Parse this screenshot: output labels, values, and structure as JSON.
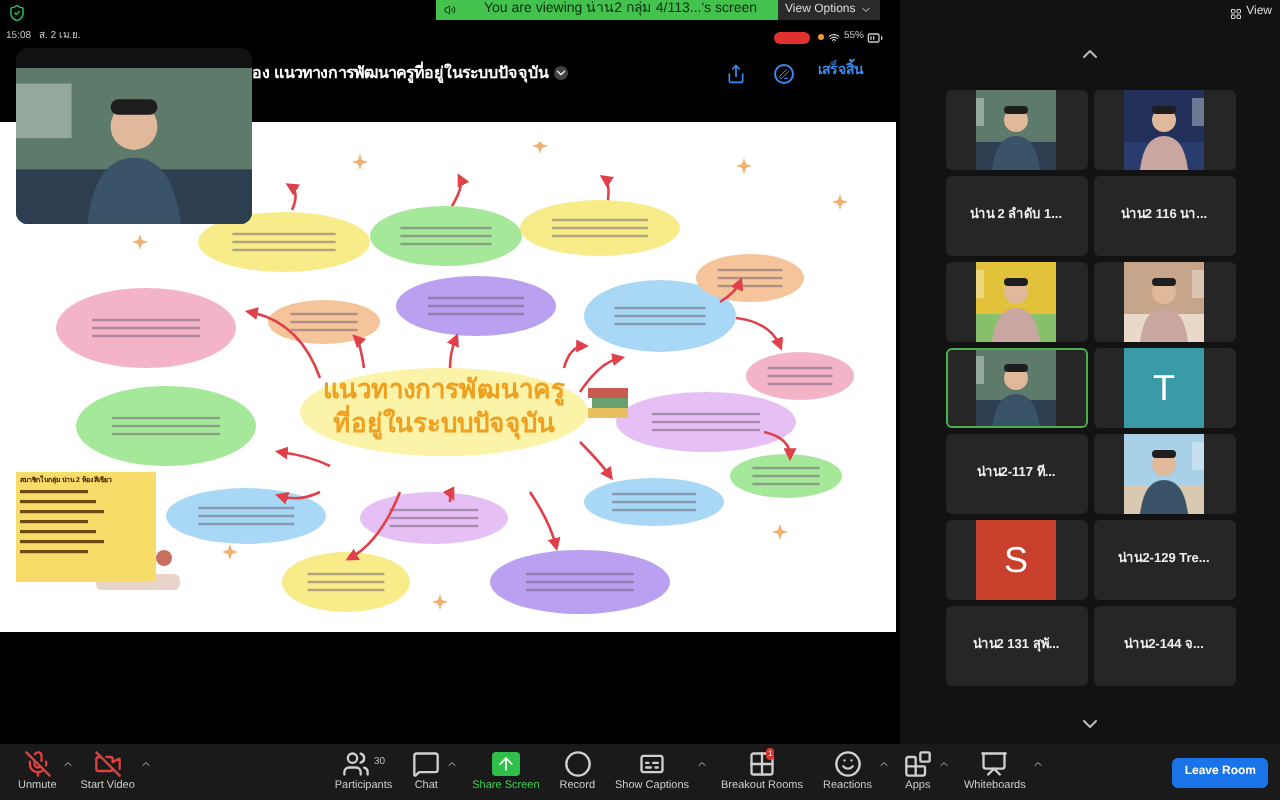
{
  "banner": {
    "text": "You are viewing น่าน2 กลุ่ม 4/113...'s screen",
    "options": "View Options"
  },
  "view_button": "View",
  "status_bar": {
    "time": "15:08",
    "date": "ส. 2 เม.ย.",
    "battery": "55%",
    "recording": true
  },
  "share_header": {
    "title": "อง แนวทางการพัฒนาครูที่อยู่ในระบบปัจจุบัน",
    "done": "เสร็จสิ้น"
  },
  "slide": {
    "title_lines": [
      "แนวทางการพัฒนาครู",
      "ที่อยู่ในระบบปัจจุบัน"
    ],
    "legend_title": "สมาชิกในกลุ่ม น่าน 2 ห้องสีเขียว"
  },
  "participants": [
    {
      "kind": "video",
      "active": false
    },
    {
      "kind": "video",
      "active": false
    },
    {
      "kind": "name",
      "name": "น่าน 2 ลำดับ 1...",
      "active": false
    },
    {
      "kind": "name",
      "name": "น่าน2 116 นา...",
      "active": false
    },
    {
      "kind": "video",
      "active": false
    },
    {
      "kind": "video",
      "active": false
    },
    {
      "kind": "video",
      "active": true
    },
    {
      "kind": "avatar",
      "letter": "T",
      "color": "#3a9aa6",
      "active": false
    },
    {
      "kind": "name",
      "name": "น่าน2-117 ที...",
      "active": false
    },
    {
      "kind": "video",
      "active": false
    },
    {
      "kind": "avatar",
      "letter": "S",
      "color": "#c8402c",
      "active": false
    },
    {
      "kind": "name",
      "name": "น่าน2-129 Tre...",
      "active": false
    },
    {
      "kind": "name",
      "name": "น่าน2 131 สุพั...",
      "active": false
    },
    {
      "kind": "name",
      "name": "น่าน2-144 จ...",
      "active": false
    }
  ],
  "toolbar": [
    {
      "kind": "mic-off",
      "label": "Unmute",
      "caret": true
    },
    {
      "kind": "video-off",
      "label": "Start Video",
      "caret": true
    },
    {
      "kind": "people",
      "label": "Participants",
      "count": "30"
    },
    {
      "kind": "chat",
      "label": "Chat",
      "caret": true
    },
    {
      "kind": "share",
      "label": "Share Screen"
    },
    {
      "kind": "record",
      "label": "Record"
    },
    {
      "kind": "captions",
      "label": "Show Captions",
      "caret": true
    },
    {
      "kind": "rooms",
      "label": "Breakout Rooms",
      "badge": "1"
    },
    {
      "kind": "reactions",
      "label": "Reactions",
      "caret": true
    },
    {
      "kind": "apps",
      "label": "Apps",
      "caret": true
    },
    {
      "kind": "whiteboard",
      "label": "Whiteboards",
      "caret": true
    }
  ],
  "leave": "Leave Room"
}
